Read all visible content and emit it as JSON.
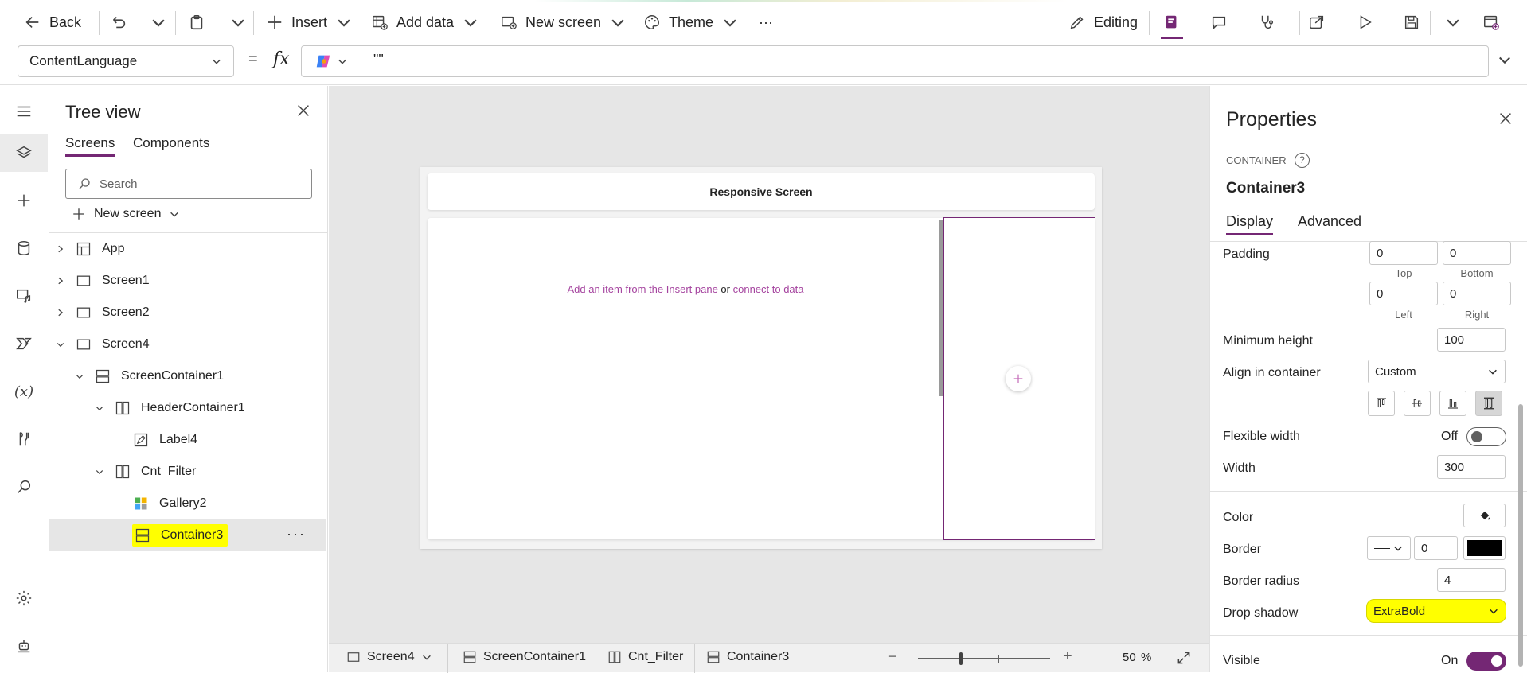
{
  "toolbar": {
    "back": "Back",
    "insert": "Insert",
    "add_data": "Add data",
    "new_screen": "New screen",
    "theme": "Theme",
    "more": "···",
    "editing": "Editing"
  },
  "formula_bar": {
    "property": "ContentLanguage",
    "equals": "=",
    "fx": "fx",
    "value": "\"\""
  },
  "tree_view": {
    "title": "Tree view",
    "tabs": [
      "Screens",
      "Components"
    ],
    "search_placeholder": "Search",
    "new_screen": "New screen",
    "items": [
      {
        "label": "App",
        "icon": "app-icon"
      },
      {
        "label": "Screen1",
        "icon": "screen-icon"
      },
      {
        "label": "Screen2",
        "icon": "screen-icon"
      },
      {
        "label": "Screen4",
        "icon": "screen-icon"
      },
      {
        "label": "ScreenContainer1",
        "icon": "vertical-container-icon"
      },
      {
        "label": "HeaderContainer1",
        "icon": "horizontal-container-icon"
      },
      {
        "label": "Label4",
        "icon": "label-icon"
      },
      {
        "label": "Cnt_Filter",
        "icon": "horizontal-container-icon"
      },
      {
        "label": "Gallery2",
        "icon": "gallery-icon"
      },
      {
        "label": "Container3",
        "icon": "vertical-container-icon"
      }
    ]
  },
  "canvas": {
    "header_title": "Responsive Screen",
    "hint_part1": "Add an item from the Insert pane",
    "hint_or": "or",
    "hint_part2": "connect to data"
  },
  "status_bar": {
    "crumbs": [
      "Screen4",
      "ScreenContainer1",
      "Cnt_Filter",
      "Container3"
    ],
    "zoom_value": "50",
    "zoom_unit": "%"
  },
  "properties": {
    "title": "Properties",
    "type": "CONTAINER",
    "name": "Container3",
    "tabs": [
      "Display",
      "Advanced"
    ],
    "padding_label": "Padding",
    "padding": {
      "top": "0",
      "bottom": "0",
      "left": "0",
      "right": "0"
    },
    "padding_sub": {
      "top": "Top",
      "bottom": "Bottom",
      "left": "Left",
      "right": "Right"
    },
    "min_height_label": "Minimum height",
    "min_height": "100",
    "align_label": "Align in container",
    "align_value": "Custom",
    "flex_width_label": "Flexible width",
    "flex_width_value": "Off",
    "width_label": "Width",
    "width": "300",
    "color_label": "Color",
    "border_label": "Border",
    "border_width": "0",
    "border_color": "#000000",
    "border_radius_label": "Border radius",
    "border_radius": "4",
    "drop_shadow_label": "Drop shadow",
    "drop_shadow": "ExtraBold",
    "visible_label": "Visible",
    "visible_value": "On"
  },
  "colors": {
    "accent": "#742774",
    "highlight": "#ffff00"
  }
}
